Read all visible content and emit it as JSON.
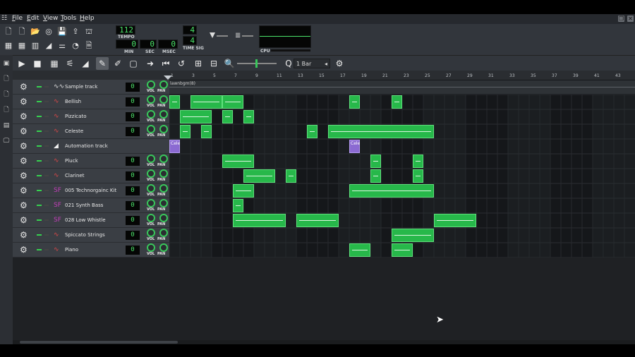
{
  "menu": [
    {
      "label": "File",
      "u": "F",
      "rest": "ile"
    },
    {
      "label": "Edit",
      "u": "E",
      "rest": "dit"
    },
    {
      "label": "View",
      "u": "V",
      "rest": "iew"
    },
    {
      "label": "Tools",
      "u": "T",
      "rest": "ools"
    },
    {
      "label": "Help",
      "u": "H",
      "rest": "elp"
    }
  ],
  "transport": {
    "tempo": "112",
    "tempo_label": "TEMPO",
    "min": "0",
    "sec": "0",
    "msec": "0",
    "min_label": "MIN",
    "sec_label": "SEC",
    "msec_label": "MSEC",
    "timesig_num": "4",
    "timesig_den": "4",
    "timesig_label": "TIME SIG",
    "cpu_label": "CPU"
  },
  "song_toolbar": {
    "zoom": "1 Bar"
  },
  "ruler": {
    "bars": [
      "1",
      "3",
      "5",
      "7",
      "9",
      "11",
      "13",
      "15",
      "17",
      "19",
      "21",
      "23",
      "25",
      "27",
      "29",
      "31",
      "33",
      "35",
      "37",
      "39",
      "41",
      "43"
    ]
  },
  "tracks": [
    {
      "name": "Sample track",
      "type": "sample",
      "icon": "waveform-icon",
      "value": "0"
    },
    {
      "name": "Bellish",
      "type": "instrument",
      "icon": "tripleoscillator-icon",
      "value": "0"
    },
    {
      "name": "Pizzicato",
      "type": "instrument",
      "icon": "tripleoscillator-icon",
      "value": "0"
    },
    {
      "name": "Celeste",
      "type": "instrument",
      "icon": "tripleoscillator-icon",
      "value": "0"
    },
    {
      "name": "Automation track",
      "type": "automation",
      "icon": "automation-icon",
      "value": ""
    },
    {
      "name": "Pluck",
      "type": "instrument",
      "icon": "tripleoscillator-icon",
      "value": "0"
    },
    {
      "name": "Clarinet",
      "type": "instrument",
      "icon": "tripleoscillator-icon",
      "value": "0"
    },
    {
      "name": "005 Technorgainc Kit",
      "type": "instrument",
      "icon": "sf2-icon",
      "value": "0"
    },
    {
      "name": "021 Synth Bass",
      "type": "instrument",
      "icon": "sf2-icon",
      "value": "0"
    },
    {
      "name": "028 Low Whistle",
      "type": "instrument",
      "icon": "sf2-icon",
      "value": "0"
    },
    {
      "name": "Spiccato Strings",
      "type": "instrument",
      "icon": "tripleoscillator-icon",
      "value": "0"
    },
    {
      "name": "Piano",
      "type": "instrument",
      "icon": "tripleoscillator-icon",
      "value": "0"
    }
  ],
  "knob_labels": {
    "vol": "VOL",
    "pan": "PAN"
  },
  "sample_clip_label": "lawnbgm(8)",
  "automation_clip_labels": [
    "Cele",
    "Cele"
  ],
  "colors": {
    "clip_green": "#27b84a",
    "automation_purple": "#8b6ad2",
    "lcd_green": "#4be36a",
    "background": "#32363c"
  }
}
